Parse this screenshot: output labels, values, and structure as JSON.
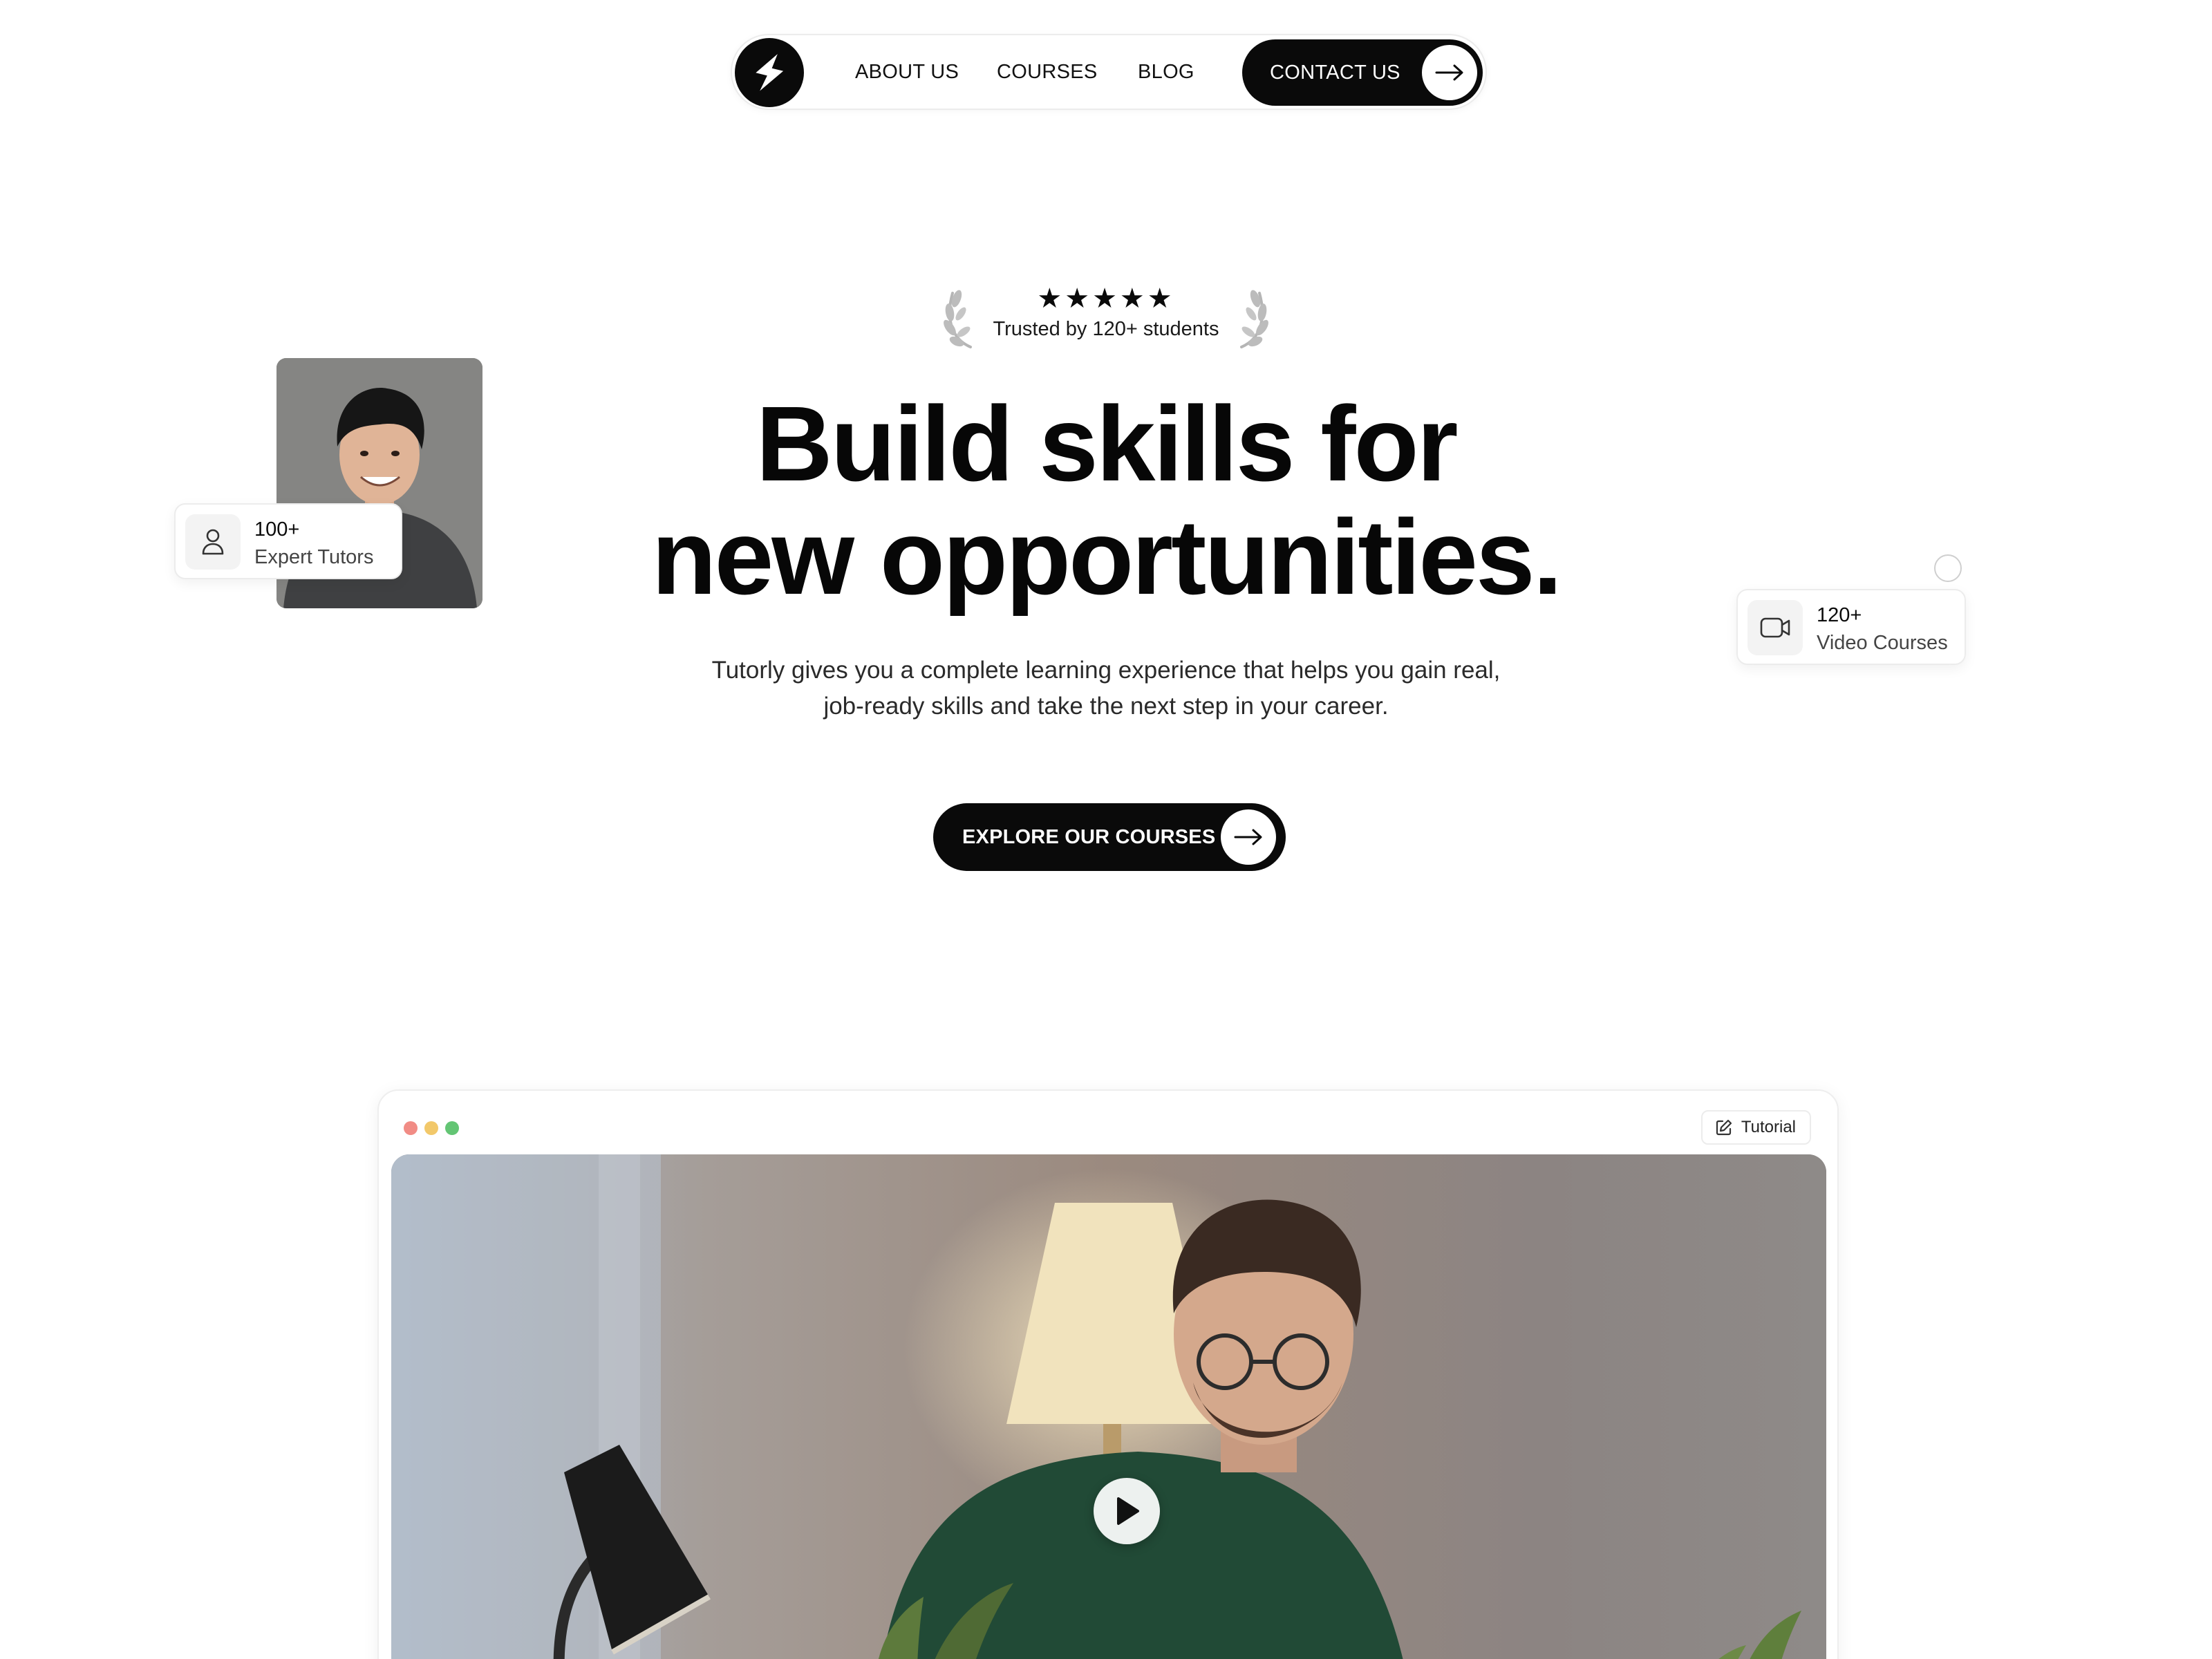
{
  "nav": {
    "links": [
      {
        "label": "ABOUT US"
      },
      {
        "label": "COURSES"
      },
      {
        "label": "BLOG"
      }
    ],
    "contact_label": "CONTACT US"
  },
  "hero": {
    "stars": "★★★★★",
    "rating_count": 5,
    "trusted_text": "Trusted by 120+ students",
    "title_line1": "Build skills for",
    "title_line2": "new opportunities.",
    "subtitle_line1": "Tutorly gives you a complete learning experience that helps you gain real,",
    "subtitle_line2": "job-ready skills and take the next step in your career.",
    "cta_label": "EXPLORE OUR COURSES"
  },
  "stats": {
    "tutors": {
      "number": "100+",
      "label": "Expert Tutors",
      "icon": "user-icon"
    },
    "courses": {
      "number": "120+",
      "label": "Video Courses",
      "icon": "video-camera-icon"
    }
  },
  "player": {
    "tag_label": "Tutorial",
    "tag_icon": "edit-icon",
    "window_dots": [
      "#f18c85",
      "#f2c86a",
      "#63c574"
    ]
  },
  "colors": {
    "primary": "#0a0a0a",
    "background": "#ffffff",
    "muted_text": "#2a2a2a"
  }
}
